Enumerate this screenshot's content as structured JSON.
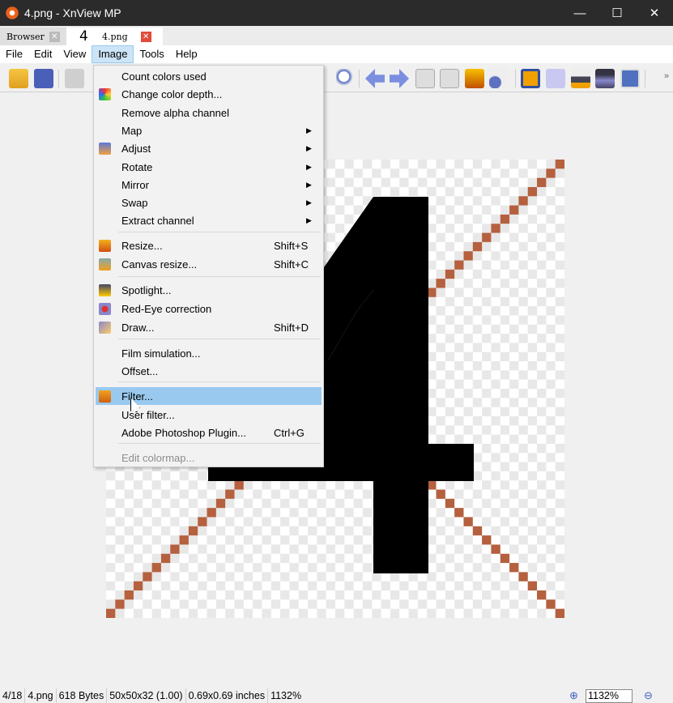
{
  "window": {
    "title": "4.png - XnView MP",
    "minimize": "—",
    "maximize": "☐",
    "close": "✕"
  },
  "tabs": [
    {
      "label": "Browser",
      "close": "✕"
    },
    {
      "thumb": "4",
      "label": "4.png",
      "close": "✕"
    }
  ],
  "menubar": [
    "File",
    "Edit",
    "View",
    "Image",
    "Tools",
    "Help"
  ],
  "toolbar": {
    "overflow": "»"
  },
  "image_menu": {
    "items": [
      {
        "label": "Count colors used"
      },
      {
        "label": "Change color depth...",
        "icon": "color-depth-icon"
      },
      {
        "label": "Remove alpha channel"
      },
      {
        "label": "Map",
        "submenu": true
      },
      {
        "label": "Adjust",
        "submenu": true,
        "icon": "adjust-icon"
      },
      {
        "label": "Rotate",
        "submenu": true
      },
      {
        "label": "Mirror",
        "submenu": true
      },
      {
        "label": "Swap",
        "submenu": true
      },
      {
        "label": "Extract channel",
        "submenu": true
      },
      {
        "label": "Resize...",
        "shortcut": "Shift+S",
        "icon": "resize-icon"
      },
      {
        "label": "Canvas resize...",
        "shortcut": "Shift+C",
        "icon": "canvas-resize-icon"
      },
      {
        "label": "Spotlight...",
        "icon": "spotlight-icon"
      },
      {
        "label": "Red-Eye correction",
        "icon": "red-eye-icon"
      },
      {
        "label": "Draw...",
        "shortcut": "Shift+D",
        "icon": "draw-icon"
      },
      {
        "label": "Film simulation..."
      },
      {
        "label": "Offset..."
      },
      {
        "label": "Filter...",
        "icon": "filter-icon",
        "highlighted": true
      },
      {
        "label": "User filter..."
      },
      {
        "label": "Adobe Photoshop Plugin...",
        "shortcut": "Ctrl+G"
      },
      {
        "label": "Edit colormap...",
        "disabled": true
      }
    ],
    "submenu_arrow": "▶"
  },
  "statusbar": {
    "index": "4/18",
    "filename": "4.png",
    "size": "618 Bytes",
    "dimensions": "50x50x32 (1.00)",
    "inches": "0.69x0.69 inches",
    "zoom": "1132%",
    "zoom_field": "1132%"
  },
  "colors": {
    "accent": "#99c9ef",
    "line": "#b5603e"
  }
}
